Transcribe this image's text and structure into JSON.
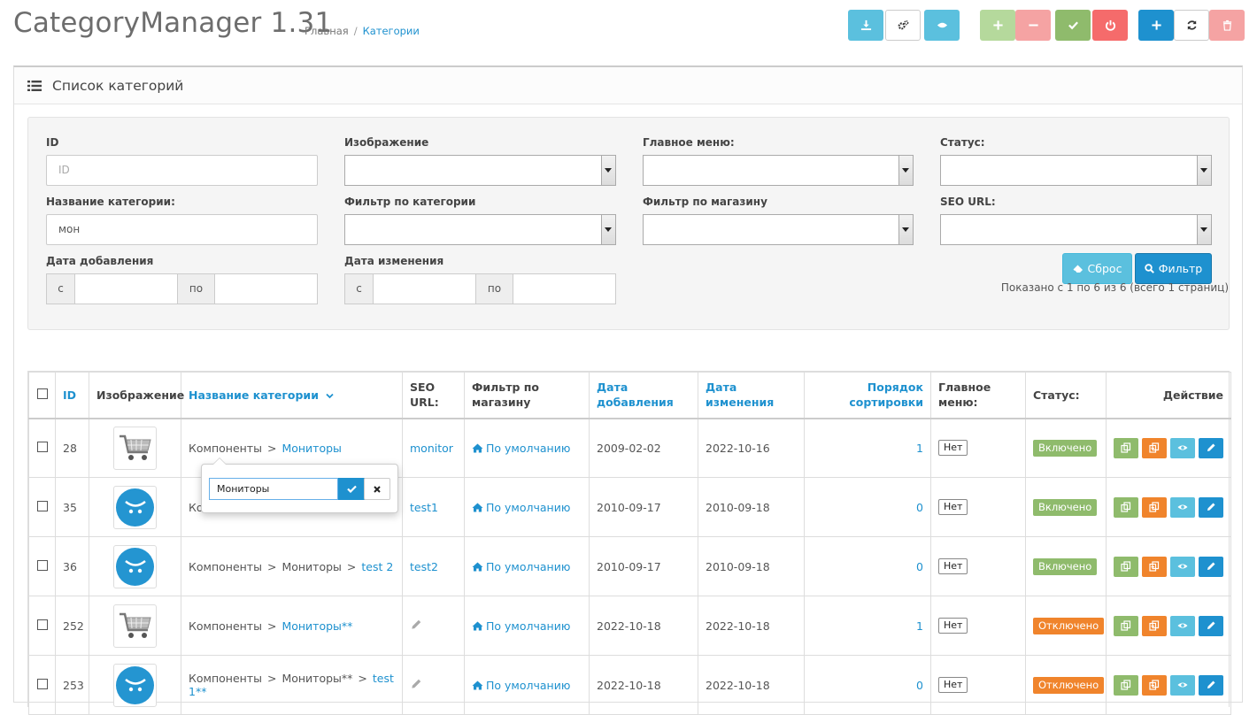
{
  "header": {
    "title": "CategoryManager 1.31",
    "breadcrumb": [
      "Главная",
      "Категории"
    ]
  },
  "toolbar": [
    {
      "name": "download-button",
      "icon": "download-icon",
      "color": "#5bc0de",
      "text_color": "#ffffff"
    },
    {
      "name": "settings-button",
      "icon": "cogs-icon",
      "color": "#ffffff",
      "text_color": "#333333"
    },
    {
      "name": "view-button",
      "icon": "eye-icon",
      "color": "#5bc0de",
      "text_color": "#ffffff"
    },
    {
      "name": "expand-all-button",
      "icon": "plus-icon",
      "color": "#b5d99c",
      "text_color": "#ffffff"
    },
    {
      "name": "collapse-all-button",
      "icon": "minus-icon",
      "color": "#f5a3a3",
      "text_color": "#ffffff"
    },
    {
      "name": "enable-button",
      "icon": "check-icon",
      "color": "#8fbb6c",
      "text_color": "#ffffff"
    },
    {
      "name": "disable-button",
      "icon": "power-icon",
      "color": "#f56b6b",
      "text_color": "#ffffff"
    },
    {
      "name": "add-button",
      "icon": "plus-icon",
      "color": "#1e91cf",
      "text_color": "#ffffff"
    },
    {
      "name": "refresh-button",
      "icon": "refresh-icon",
      "color": "#ffffff",
      "text_color": "#333333"
    },
    {
      "name": "delete-button",
      "icon": "trash-icon",
      "color": "#f5a3a3",
      "text_color": "#ffffff"
    }
  ],
  "panel": {
    "title": "Список категорий"
  },
  "filter": {
    "id_label": "ID",
    "id_placeholder": "ID",
    "image_label": "Изображение",
    "main_menu_label": "Главное меню:",
    "status_label": "Статус:",
    "name_label": "Название категории:",
    "name_value": "мон",
    "category_filter_label": "Фильтр по категории",
    "store_filter_label": "Фильтр по магазину",
    "seo_label": "SEO URL:",
    "date_added_label": "Дата добавления",
    "date_modified_label": "Дата изменения",
    "from": "с",
    "to": "по",
    "reset_label": "Сброс",
    "filter_label": "Фильтр"
  },
  "shown_text": "Показано с 1 по 6 из 6 (всего 1 страниц)",
  "table": {
    "headers": {
      "id": "ID",
      "image": "Изображение",
      "name": "Название категории",
      "seo": "SEO URL:",
      "store": "Фильтр по магазину",
      "date_added": "Дата добавления",
      "date_modified": "Дата изменения",
      "sort_order": "Порядок сортировки",
      "main_menu": "Главное меню:",
      "status": "Статус:",
      "action": "Действие"
    },
    "rows": [
      {
        "id": "28",
        "image": "cart",
        "path": [
          "Компоненты"
        ],
        "name": "Мониторы",
        "seo": "monitor",
        "store": "По умолчанию",
        "date_added": "2009-02-02",
        "date_modified": "2022-10-16",
        "sort_order": "1",
        "main_menu": "Нет",
        "status": "Включено",
        "status_color": "#8fbb6c"
      },
      {
        "id": "35",
        "image": "opencart",
        "path": [
          "Ко"
        ],
        "name": "",
        "seo": "test1",
        "store": "По умолчанию",
        "date_added": "2010-09-17",
        "date_modified": "2010-09-18",
        "sort_order": "0",
        "main_menu": "Нет",
        "status": "Включено",
        "status_color": "#8fbb6c"
      },
      {
        "id": "36",
        "image": "opencart",
        "path": [
          "Компоненты",
          "Мониторы"
        ],
        "name": "test 2",
        "seo": "test2",
        "store": "По умолчанию",
        "date_added": "2010-09-17",
        "date_modified": "2010-09-18",
        "sort_order": "0",
        "main_menu": "Нет",
        "status": "Включено",
        "status_color": "#8fbb6c"
      },
      {
        "id": "252",
        "image": "cart",
        "path": [
          "Компоненты"
        ],
        "name": "Мониторы**",
        "seo": "",
        "store": "По умолчанию",
        "date_added": "2022-10-18",
        "date_modified": "2022-10-18",
        "sort_order": "1",
        "main_menu": "Нет",
        "status": "Отключено",
        "status_color": "#f0842c"
      },
      {
        "id": "253",
        "image": "opencart",
        "path": [
          "Компоненты",
          "Мониторы**"
        ],
        "name": "test 1**",
        "seo": "",
        "store": "По умолчанию",
        "date_added": "2022-10-18",
        "date_modified": "2022-10-18",
        "sort_order": "0",
        "main_menu": "Нет",
        "status": "Отключено",
        "status_color": "#f0842c"
      }
    ],
    "action_buttons": [
      {
        "name": "copy-button",
        "icon": "copy-icon",
        "color": "#8fbb6c"
      },
      {
        "name": "clone-button",
        "icon": "clone-icon",
        "color": "#f0842c"
      },
      {
        "name": "view-button",
        "icon": "eye-icon",
        "color": "#5bc0de"
      },
      {
        "name": "edit-button",
        "icon": "pencil-icon",
        "color": "#1e91cf"
      }
    ]
  },
  "popover": {
    "input_value": "Мониторы"
  }
}
